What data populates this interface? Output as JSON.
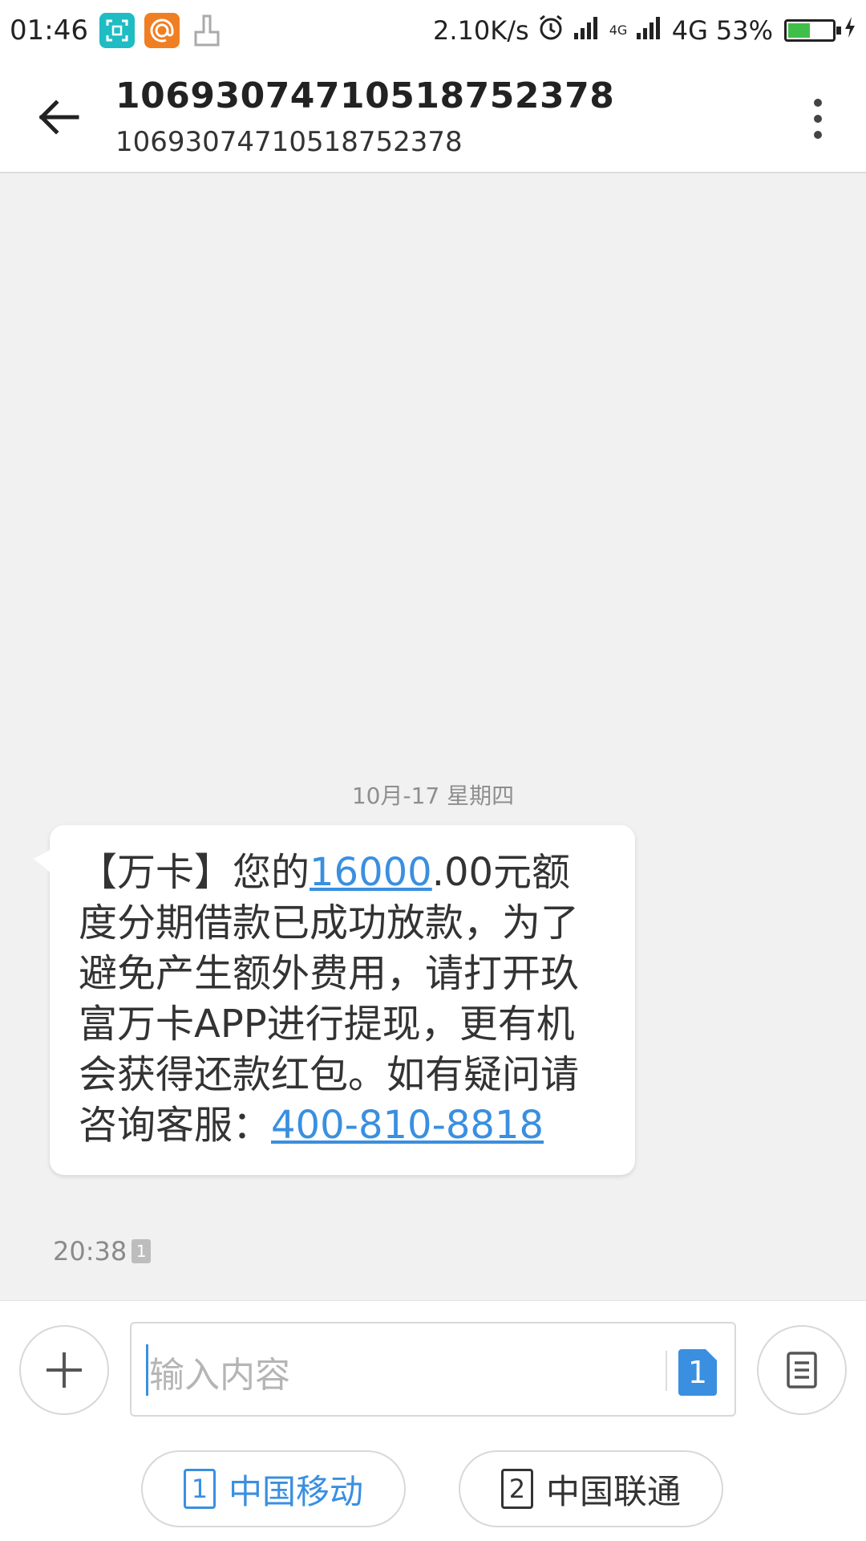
{
  "status_bar": {
    "time": "01:46",
    "net_speed": "2.10K/s",
    "network_label_1": "4G",
    "network_label_2": "4G",
    "battery_percent_text": "53%",
    "battery_level": 0.53
  },
  "header": {
    "title": "10693074710518752378",
    "subtitle": "10693074710518752378"
  },
  "conversation": {
    "date_divider": "10月-17  星期四",
    "message": {
      "prefix": "【万卡】您的",
      "amount_link": "16000",
      "body": ".00元额度分期借款已成功放款，为了避免产生额外费用，请打开玖富万卡APP进行提现，更有机会获得还款红包。如有疑问请咨询客服：",
      "phone_link": "400-810-8818",
      "time": "20:38",
      "sim_slot": "1"
    }
  },
  "composer": {
    "placeholder": "输入内容",
    "send_sim": "1",
    "carriers": [
      {
        "slot": "1",
        "name": "中国移动"
      },
      {
        "slot": "2",
        "name": "中国联通"
      }
    ]
  }
}
